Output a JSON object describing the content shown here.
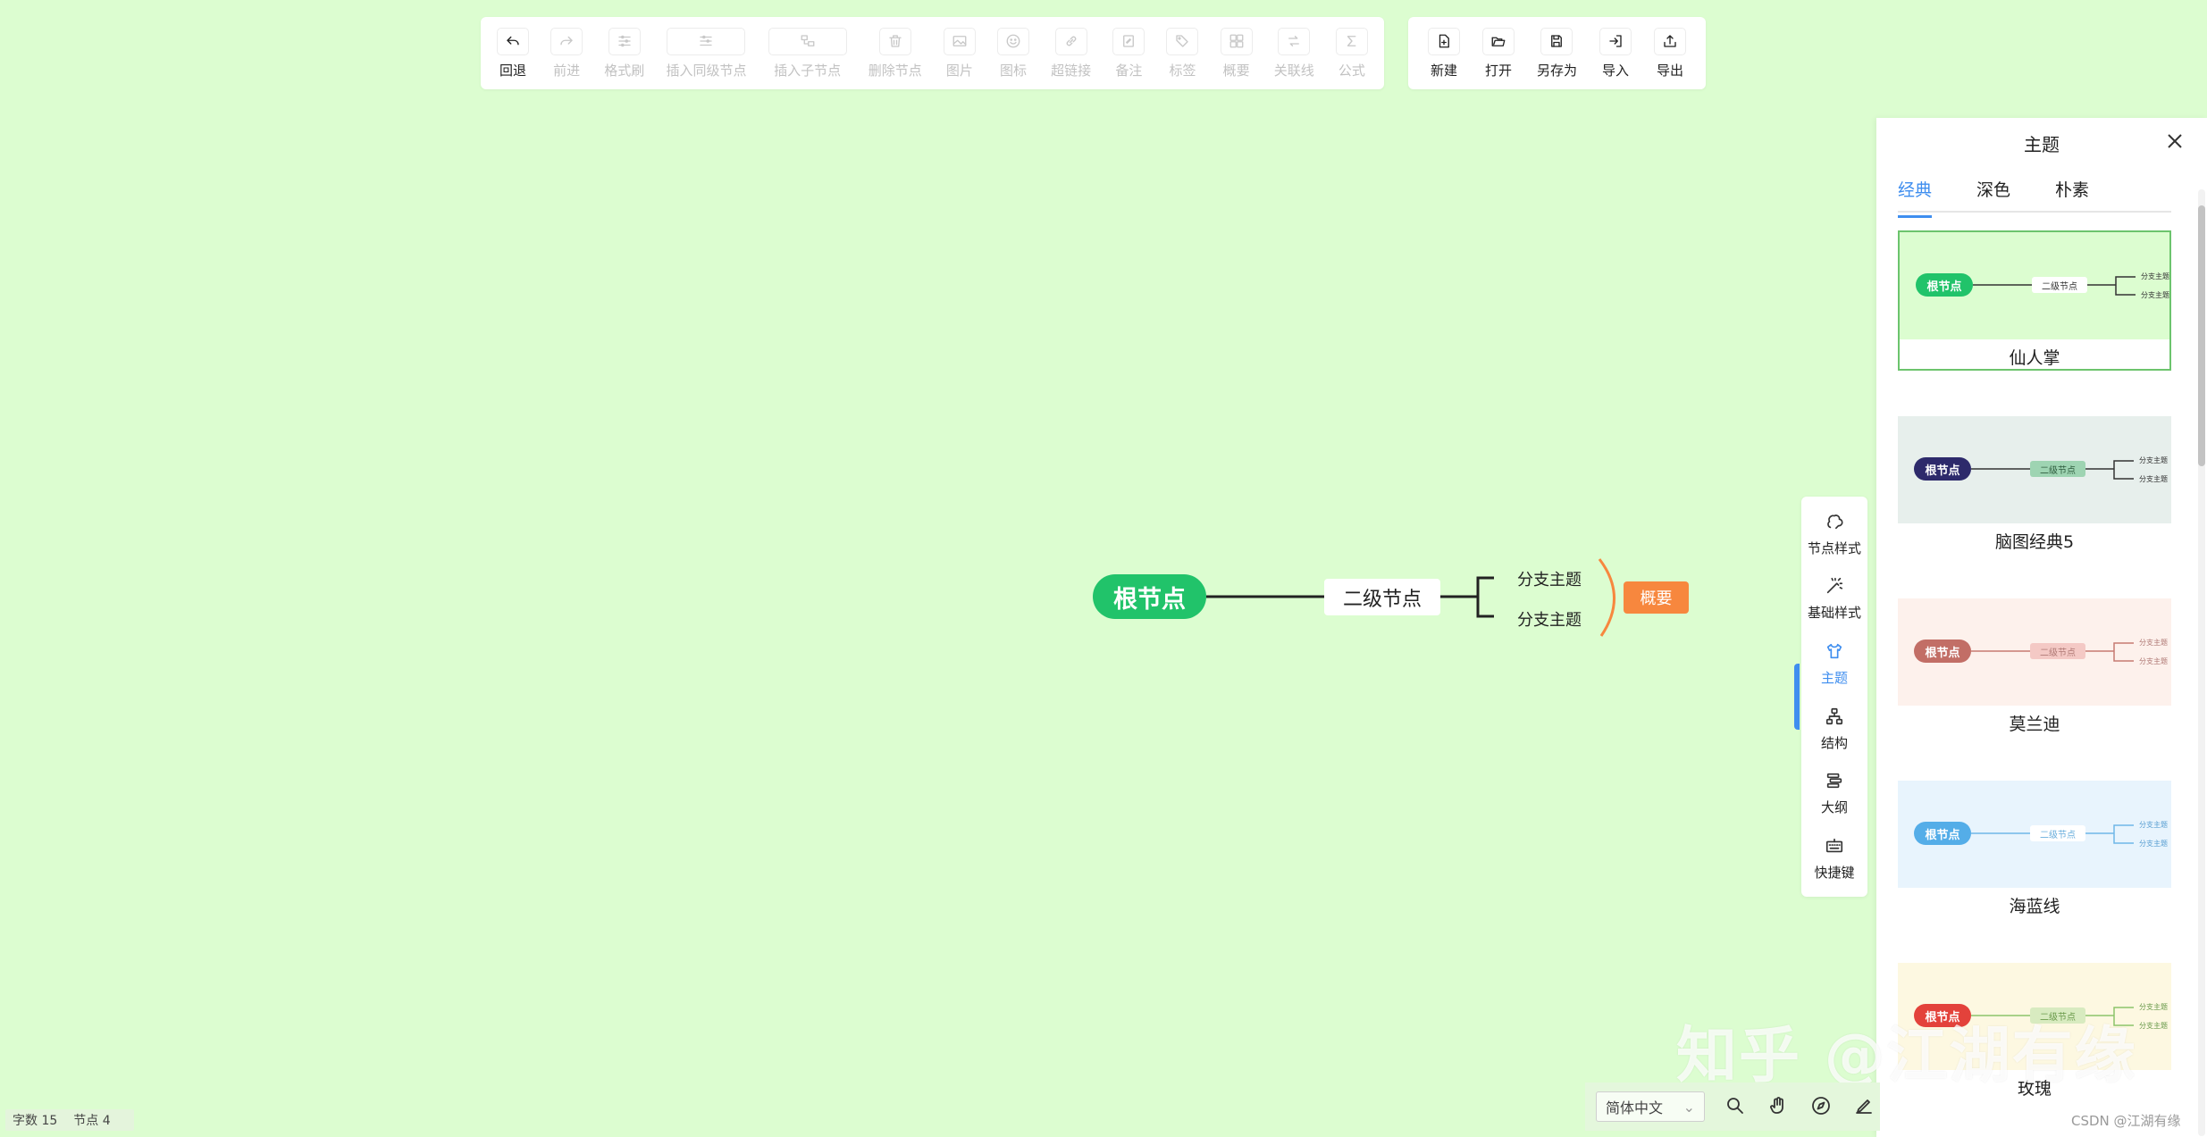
{
  "toolbar": {
    "main": [
      {
        "label": "回退",
        "icon": "undo-icon",
        "enabled": true
      },
      {
        "label": "前进",
        "icon": "redo-icon",
        "enabled": false
      },
      {
        "label": "格式刷",
        "icon": "format-brush-icon",
        "enabled": false
      },
      {
        "label": "插入同级节点",
        "icon": "sibling-node-icon",
        "enabled": false
      },
      {
        "label": "插入子节点",
        "icon": "child-node-icon",
        "enabled": false
      },
      {
        "label": "删除节点",
        "icon": "trash-icon",
        "enabled": false
      },
      {
        "label": "图片",
        "icon": "image-icon",
        "enabled": false
      },
      {
        "label": "图标",
        "icon": "smiley-icon",
        "enabled": false
      },
      {
        "label": "超链接",
        "icon": "link-icon",
        "enabled": false
      },
      {
        "label": "备注",
        "icon": "note-icon",
        "enabled": false
      },
      {
        "label": "标签",
        "icon": "tag-icon",
        "enabled": false
      },
      {
        "label": "概要",
        "icon": "summary-icon",
        "enabled": false
      },
      {
        "label": "关联线",
        "icon": "relation-line-icon",
        "enabled": false
      },
      {
        "label": "公式",
        "icon": "formula-icon",
        "enabled": false
      }
    ],
    "file": [
      {
        "label": "新建",
        "icon": "new-file-icon"
      },
      {
        "label": "打开",
        "icon": "folder-open-icon"
      },
      {
        "label": "另存为",
        "icon": "save-as-icon"
      },
      {
        "label": "导入",
        "icon": "import-icon"
      },
      {
        "label": "导出",
        "icon": "export-icon"
      }
    ]
  },
  "mindmap": {
    "root": "根节点",
    "second": "二级节点",
    "branches": [
      "分支主题",
      "分支主题"
    ],
    "summary": "概要",
    "colors": {
      "root": "#21c36a",
      "summary": "#f7873e",
      "background": "#dcfdd0"
    }
  },
  "side_strip": [
    {
      "label": "节点样式",
      "icon": "node-style-icon",
      "active": false
    },
    {
      "label": "基础样式",
      "icon": "magic-wand-icon",
      "active": false
    },
    {
      "label": "主题",
      "icon": "shirt-icon",
      "active": true
    },
    {
      "label": "结构",
      "icon": "structure-icon",
      "active": false
    },
    {
      "label": "大纲",
      "icon": "outline-icon",
      "active": false
    },
    {
      "label": "快捷键",
      "icon": "keyboard-icon",
      "active": false
    }
  ],
  "panel": {
    "title": "主题",
    "tabs": [
      "经典",
      "深色",
      "朴素"
    ],
    "themes": [
      {
        "name": "仙人掌",
        "bg": "#dcfdd0",
        "root_bg": "#21c36a",
        "root_text": "根节点",
        "second_text": "二级节点",
        "second_bg": "#ffffff",
        "second_color": "#333333",
        "line": "#333333",
        "branch_color": "#333333",
        "branches": [
          "分支主题",
          "分支主题"
        ]
      },
      {
        "name": "脑图经典5",
        "bg": "#e7efec",
        "root_bg": "#2d2a6b",
        "root_text": "根节点",
        "second_text": "二级节点",
        "second_bg": "#9ed4b2",
        "second_color": "#2e5c3e",
        "line": "#333333",
        "branch_color": "#333333",
        "branches": [
          "分支主题",
          "分支主题"
        ]
      },
      {
        "name": "莫兰迪",
        "bg": "#fdf1ec",
        "root_bg": "#c26e66",
        "root_text": "根节点",
        "second_text": "二级节点",
        "second_bg": "#f4c9c5",
        "second_color": "#b07a76",
        "line": "#c77a72",
        "branch_color": "#b07a76",
        "branches": [
          "分支主题",
          "分支主题"
        ]
      },
      {
        "name": "海蓝线",
        "bg": "#e8f4fd",
        "root_bg": "#54ade8",
        "root_text": "根节点",
        "second_text": "二级节点",
        "second_bg": "#ffffff",
        "second_color": "#6aaedc",
        "line": "#6fb6e8",
        "branch_color": "#5a9fd2",
        "branches": [
          "分支主题",
          "分支主题"
        ]
      },
      {
        "name": "玫瑰",
        "bg": "#fdf8e1",
        "root_bg": "#e3423b",
        "root_text": "根节点",
        "second_text": "二级节点",
        "second_bg": "#d8ebc0",
        "second_color": "#6a9a4b",
        "line": "#8bc46a",
        "branch_color": "#6a9a4b",
        "branches": [
          "分支主题",
          "分支主题"
        ]
      }
    ]
  },
  "status": {
    "words": "字数 15",
    "nodes": "节点 4"
  },
  "bottom": {
    "lang": "简体中文",
    "watermark": "知乎 @江湖有缘",
    "credit": "CSDN @江湖有缘"
  }
}
